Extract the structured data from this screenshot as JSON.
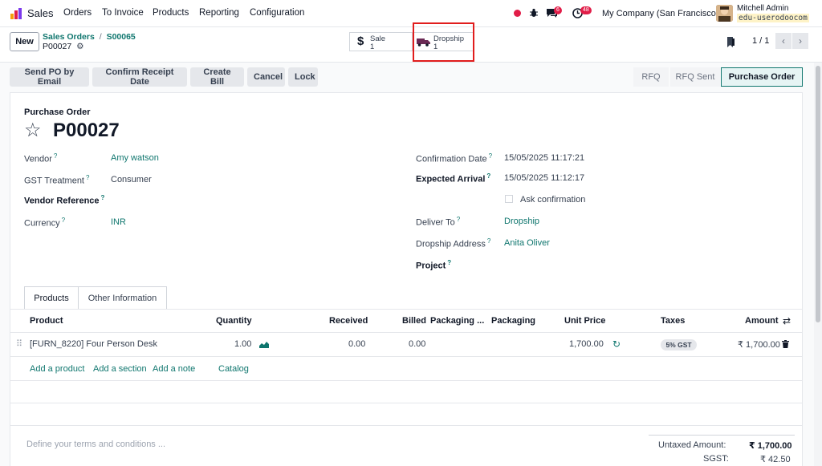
{
  "app": {
    "name": "Sales"
  },
  "nav": [
    "Orders",
    "To Invoice",
    "Products",
    "Reporting",
    "Configuration"
  ],
  "badges": {
    "messages": "6",
    "activities": "48"
  },
  "company": "My Company (San Francisco)",
  "user": {
    "name": "Mitchell Admin",
    "db": "edu-userodoocom"
  },
  "toolbar": {
    "new_label": "New",
    "breadcrumb_parent": "Sales Orders",
    "breadcrumb_child": "S00065",
    "record": "P00027"
  },
  "smart_buttons": [
    {
      "label": "Sale",
      "count": "1"
    },
    {
      "label": "Dropship",
      "count": "1"
    }
  ],
  "pager": {
    "value": "1 / 1"
  },
  "actions": [
    "Send PO by Email",
    "Confirm Receipt Date",
    "Create Bill",
    "Cancel",
    "Lock"
  ],
  "statusbar": [
    "RFQ",
    "RFQ Sent",
    "Purchase Order"
  ],
  "form": {
    "type_label": "Purchase Order",
    "name": "P00027",
    "vendor_label": "Vendor",
    "vendor": "Amy watson",
    "gst_label": "GST Treatment",
    "gst": "Consumer",
    "vendor_ref_label": "Vendor Reference",
    "currency_label": "Currency",
    "currency": "INR",
    "confirm_label": "Confirmation Date",
    "confirm": "15/05/2025 11:17:21",
    "arrival_label": "Expected Arrival",
    "arrival": "15/05/2025 11:12:17",
    "ask_label": "Ask confirmation",
    "deliver_label": "Deliver To",
    "deliver": "Dropship",
    "dropship_label": "Dropship Address",
    "dropship": "Anita Oliver",
    "project_label": "Project",
    "qmark": "?"
  },
  "tabs": [
    "Products",
    "Other Information"
  ],
  "table": {
    "headers": [
      "Product",
      "Quantity",
      "Received",
      "Billed",
      "Packaging ...",
      "Packaging",
      "Unit Price",
      "Taxes",
      "Amount"
    ],
    "row": {
      "product": "[FURN_8220] Four Person Desk",
      "qty": "1.00",
      "received": "0.00",
      "billed": "0.00",
      "price": "1,700.00",
      "tax": "5% GST",
      "amount": "₹ 1,700.00"
    },
    "add_links": [
      "Add a product",
      "Add a section",
      "Add a note",
      "Catalog"
    ]
  },
  "terms_placeholder": "Define your terms and conditions ...",
  "totals": [
    {
      "label": "Untaxed Amount:",
      "value": "₹ 1,700.00"
    },
    {
      "label": "SGST:",
      "value": "₹ 42.50"
    }
  ]
}
